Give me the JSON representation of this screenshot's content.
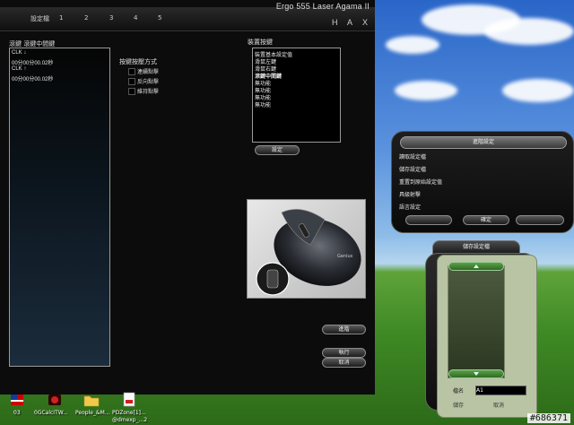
{
  "app": {
    "title": "Ergo 555 Laser Agama II",
    "window_buttons": [
      "H",
      "A",
      "X"
    ],
    "tabs": [
      "設定檔",
      "1",
      "2",
      "3",
      "4",
      "5"
    ],
    "macro_panel_label": "滾鍵 滾鍵中間鍵",
    "macro_lines": [
      "CLK ↓",
      "00分00分00.02秒",
      "CLK ↑",
      "00分00分00.02秒"
    ],
    "trigger_label": "按鍵按壓方式",
    "trigger_options": [
      "連續點擊",
      "反向點擊",
      "維持點擊"
    ],
    "button_list_label": "裝置按鍵",
    "button_items": [
      "裝置基本設定值",
      "滑鼠左鍵",
      "滑鼠右鍵",
      "滾鍵中間鍵",
      "無功能",
      "無功能",
      "無功能",
      "無功能"
    ],
    "set_button": "設定",
    "advanced_button": "進階",
    "run_button": "執行",
    "cancel_button": "取消"
  },
  "advanced_settings": {
    "header": "進階設定",
    "items": [
      "讀取設定檔",
      "儲存設定檔",
      "重置到原始設定值",
      "具級射擊",
      "語言設定"
    ],
    "ok_button": "確定"
  },
  "save_dialog": {
    "title": "儲存設定檔",
    "name_label": "檔名",
    "name_value": "A1",
    "save_button": "儲存",
    "cancel_button": "取消"
  },
  "desktop_icons": [
    {
      "label": "03",
      "icon": "flag-icon"
    },
    {
      "label": "0GCalcITW...",
      "icon": "app-icon"
    },
    {
      "label": "People_&M...",
      "icon": "folder-icon"
    },
    {
      "label": "PDZone[1]...",
      "icon": "document-icon"
    }
  ],
  "desktop_icon_sublabel": "@dmexp_...2",
  "watermark": "#686371"
}
